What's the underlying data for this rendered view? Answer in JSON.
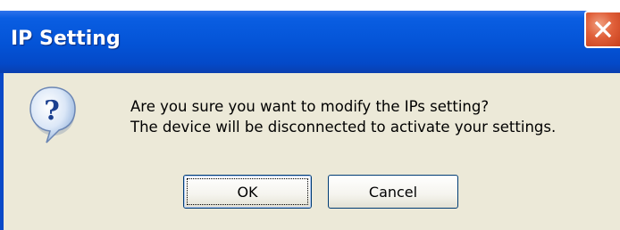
{
  "dialog": {
    "title": "IP Setting",
    "close_icon": "close-icon",
    "icon": "question-icon",
    "message_line1": "Are you sure you want to modify the IPs setting?",
    "message_line2": "The device will be disconnected to activate your settings.",
    "ok_label": "OK",
    "cancel_label": "Cancel"
  },
  "colors": {
    "titlebar": "#0453d6",
    "client": "#ece9d8",
    "close_button": "#e0603a",
    "button_border": "#003c74"
  }
}
